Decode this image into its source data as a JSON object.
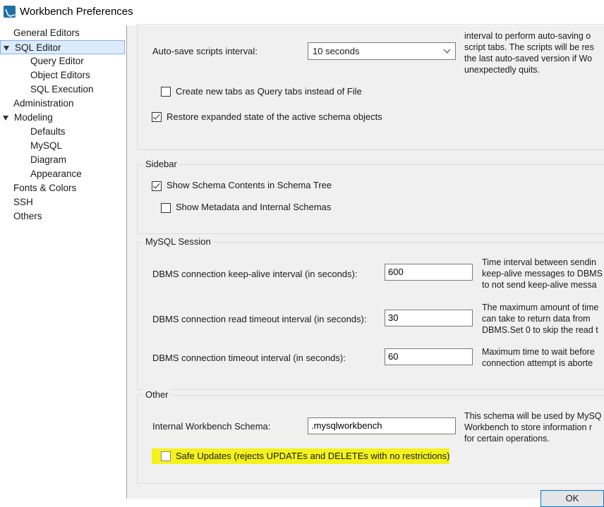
{
  "window": {
    "title": "Workbench Preferences"
  },
  "sidebar": {
    "items": [
      {
        "label": "General Editors"
      },
      {
        "label": "SQL Editor"
      },
      {
        "label": "Query Editor"
      },
      {
        "label": "Object Editors"
      },
      {
        "label": "SQL Execution"
      },
      {
        "label": "Administration"
      },
      {
        "label": "Modeling"
      },
      {
        "label": "Defaults"
      },
      {
        "label": "MySQL"
      },
      {
        "label": "Diagram"
      },
      {
        "label": "Appearance"
      },
      {
        "label": "Fonts & Colors"
      },
      {
        "label": "SSH"
      },
      {
        "label": "Others"
      }
    ],
    "selected": "SQL Editor"
  },
  "general": {
    "autosave_label": "Auto-save scripts interval:",
    "autosave_value": "10 seconds",
    "autosave_help": [
      "interval to perform auto-saving o",
      "script tabs. The scripts will be res",
      "the last auto-saved version if Wo",
      "unexpectedly quits."
    ],
    "create_tabs_label": "Create new tabs as Query tabs instead of File",
    "create_tabs_checked": false,
    "restore_label": "Restore expanded state of the active schema objects",
    "restore_checked": true
  },
  "sidebar_section": {
    "title": "Sidebar",
    "show_schema_label": "Show Schema Contents in Schema Tree",
    "show_schema_checked": true,
    "show_metadata_label": "Show Metadata and Internal Schemas",
    "show_metadata_checked": false
  },
  "session": {
    "title": "MySQL Session",
    "keepalive_label": "DBMS connection keep-alive interval (in seconds):",
    "keepalive_value": "600",
    "keepalive_help": [
      "Time interval between sendin",
      "keep-alive messages to DBMS",
      "to not send keep-alive messa"
    ],
    "read_timeout_label": "DBMS connection read timeout interval (in seconds):",
    "read_timeout_value": "30",
    "read_timeout_help": [
      "The maximum amount of time",
      "can take to return data from",
      "DBMS.Set 0 to skip the read t"
    ],
    "conn_timeout_label": "DBMS connection timeout interval (in seconds):",
    "conn_timeout_value": "60",
    "conn_timeout_help": [
      "Maximum time to wait before",
      "connection attempt is aborte"
    ]
  },
  "other": {
    "title": "Other",
    "schema_label": "Internal Workbench Schema:",
    "schema_value": ".mysqlworkbench",
    "schema_help": [
      "This schema will be used by MySQ",
      "Workbench to store information r",
      "for certain operations."
    ],
    "safe_updates_label": "Safe Updates (rejects UPDATEs and DELETEs with no restrictions)",
    "safe_updates_checked": false
  },
  "buttons": {
    "ok_label": "OK"
  },
  "colors": {
    "selection_bg": "#dcebfc",
    "highlight": "#f4f21a",
    "panel_bg": "#f0f0f0"
  }
}
